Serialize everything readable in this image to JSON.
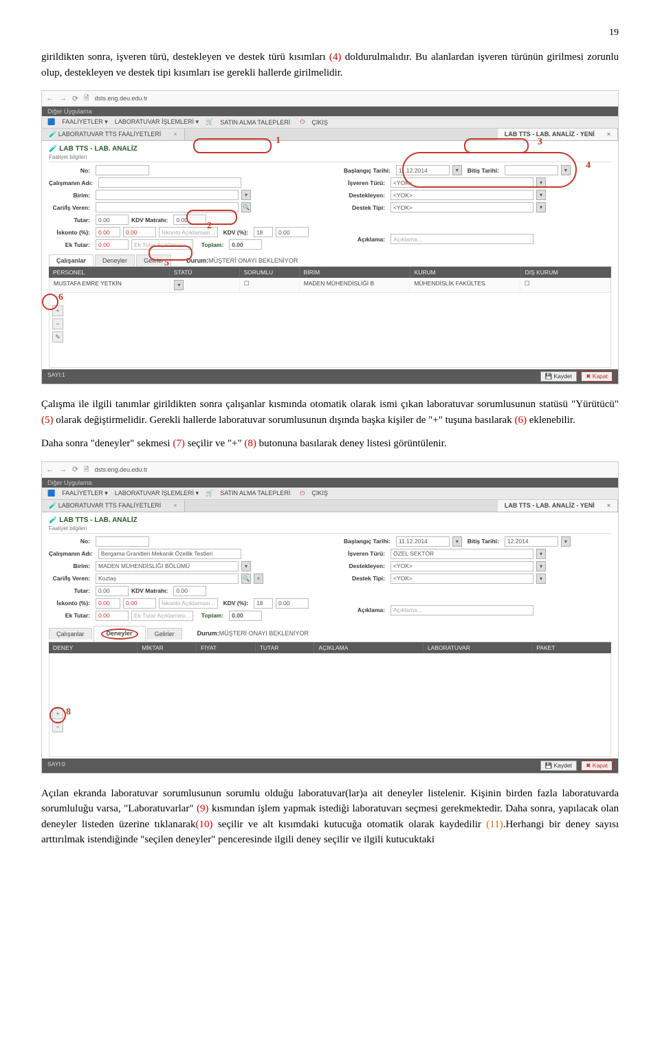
{
  "page_number": "19",
  "para1_a": "girildikten sonra, işveren türü, destekleyen ve destek türü kısımları ",
  "para1_red1": "(4)",
  "para1_b": " doldurulmalıdır. Bu alanlardan işveren türünün girilmesi zorunlu olup, destekleyen ve destek tipi kısımları ise gerekli hallerde girilmelidir.",
  "para2_a": "Çalışma ile ilgili tanımlar girildikten sonra çalışanlar kısmında otomatik olarak ismi çıkan laboratuvar sorumlusunun statüsü \"Yürütücü\" ",
  "para2_red1": "(5)",
  "para2_b": " olarak değiştirmelidir. Gerekli hallerde laboratuvar sorumlusunun dışında başka kişiler de  \"+\" tuşuna basılarak ",
  "para2_red2": "(6)",
  "para2_c": " eklenebilir.",
  "para3_a": "Daha sonra \"deneyler\" sekmesi ",
  "para3_red1": "(7)",
  "para3_b": " seçilir ve \"+\" ",
  "para3_red2": "(8)",
  "para3_c": " butonuna basılarak deney listesi görüntülenir.",
  "para4_a": "Açılan ekranda laboratuvar sorumlusunun sorumlu olduğu laboratuvar(lar)a ait deneyler listelenir. Kişinin birden fazla laboratuvarda sorumluluğu varsa, \"Laboratuvarlar\" ",
  "para4_red1": "(9)",
  "para4_b": " kısmından işlem yapmak istediği laboratuvarı seçmesi gerekmektedir. Daha sonra, yapılacak olan deneyler listeden üzerine tıklanarak",
  "para4_red2": "(10)",
  "para4_c": " seçilir ve alt kısımdaki kutucuğa otomatik olarak kaydedilir ",
  "para4_orange": "(11)",
  "para4_d": ".Herhangi bir deney sayısı arttırılmak istendiğinde \"seçilen deneyler\" penceresinde ilgili deney seçilir ve ilgili kutucuktaki",
  "browser": {
    "url": "dsts.eng.deu.edu.tr",
    "ribbon": "Diğer   Uygulama"
  },
  "menu": {
    "faaliyetler": "FAALİYETLER ▾",
    "lab": "LABORATUVAR İŞLEMLERİ ▾",
    "satin": "SATIN ALMA TALEPLERİ",
    "cikis": "ÇIKIŞ"
  },
  "tabs": {
    "tab1": "LABORATUVAR TTS FAALİYETLERİ",
    "tab2": "LAB TTS - LAB. ANALİZ - YENİ"
  },
  "form": {
    "title": "LAB TTS - LAB. ANALİZ",
    "sub": "Faaliyet bilgileri",
    "no": "No:",
    "baslangic": "Başlangıç Tarihi:",
    "baslangic_val": "11.12.2014",
    "bitis": "Bitiş Tarihi:",
    "bitis_val2": "12.2014",
    "calisma": "Çalışmanın Adı:",
    "calisma_val2": "Bergama Granitleri Mekanik Özellik Testleri",
    "birim": "Birim:",
    "birim_val2": "MADEN MÜHENDİSLİĞİ BÖLÜMÜ",
    "cari": "Cari/İş Veren:",
    "cari_val2": "Koztaş",
    "isveren": "İşveren Türü:",
    "isveren_val1": "<YOK>",
    "isveren_val2": "ÖZEL SEKTÖR",
    "destekleyen": "Destekleyen:",
    "destekleyen_val": "<YOK>",
    "destektipi": "Destek Tipi:",
    "destektipi_val": "<YOK>",
    "tutar": "Tutar:",
    "tutar_val": "0.00",
    "kdvmatrah": "KDV Matrahı:",
    "kdvmatrah_val": "0.00",
    "iskonto": "İskonto (%):",
    "iskonto_pct": "0.00",
    "iskonto_val": "0.00",
    "iskonto_acik": "İskonto Açıklaması...",
    "kdv": "KDV (%):",
    "kdv_pct": "18",
    "kdv_val": "0.00",
    "ektutar": "Ek Tutar:",
    "ektutar_val": "0.00",
    "ektutar_acik": "Ek Tutar Açıklaması...",
    "toplam": "Toplam:",
    "toplam_val": "0.00",
    "aciklama": "Açıklama:",
    "aciklama_ph": "Açıklama..."
  },
  "innerTabs": {
    "calisanlar": "Çalışanlar",
    "deneyler": "Deneyler",
    "gelirler": "Gelirler",
    "durum": "Durum:",
    "durum_val": "MÜŞTERİ ONAYI BEKLENİYOR"
  },
  "grid1": {
    "h1": "PERSONEL",
    "h2": "STATÜ",
    "h3": "SORUMLU",
    "h4": "BİRİM",
    "h5": "KURUM",
    "h6": "DIŞ KURUM",
    "r1c1": "MUSTAFA EMRE YETKİN",
    "r1c4": "MADEN MÜHENDİSLİĞİ B",
    "r1c5": "MÜHENDİSLİK FAKÜLTES"
  },
  "grid2": {
    "h1": "DENEY",
    "h2": "MİKTAR",
    "h3": "FİYAT",
    "h4": "TUTAR",
    "h5": "AÇIKLAMA",
    "h6": "LABORATUVAR",
    "h7": "PAKET"
  },
  "footer": {
    "sayi1": "SAYI:1",
    "sayi0": "SAYI:0",
    "kaydet": "Kaydet",
    "kapat": "Kapat"
  },
  "ann": {
    "n1": "1",
    "n2": "2",
    "n3": "3",
    "n4": "4",
    "n5": "5",
    "n6": "6",
    "n8": "8"
  }
}
